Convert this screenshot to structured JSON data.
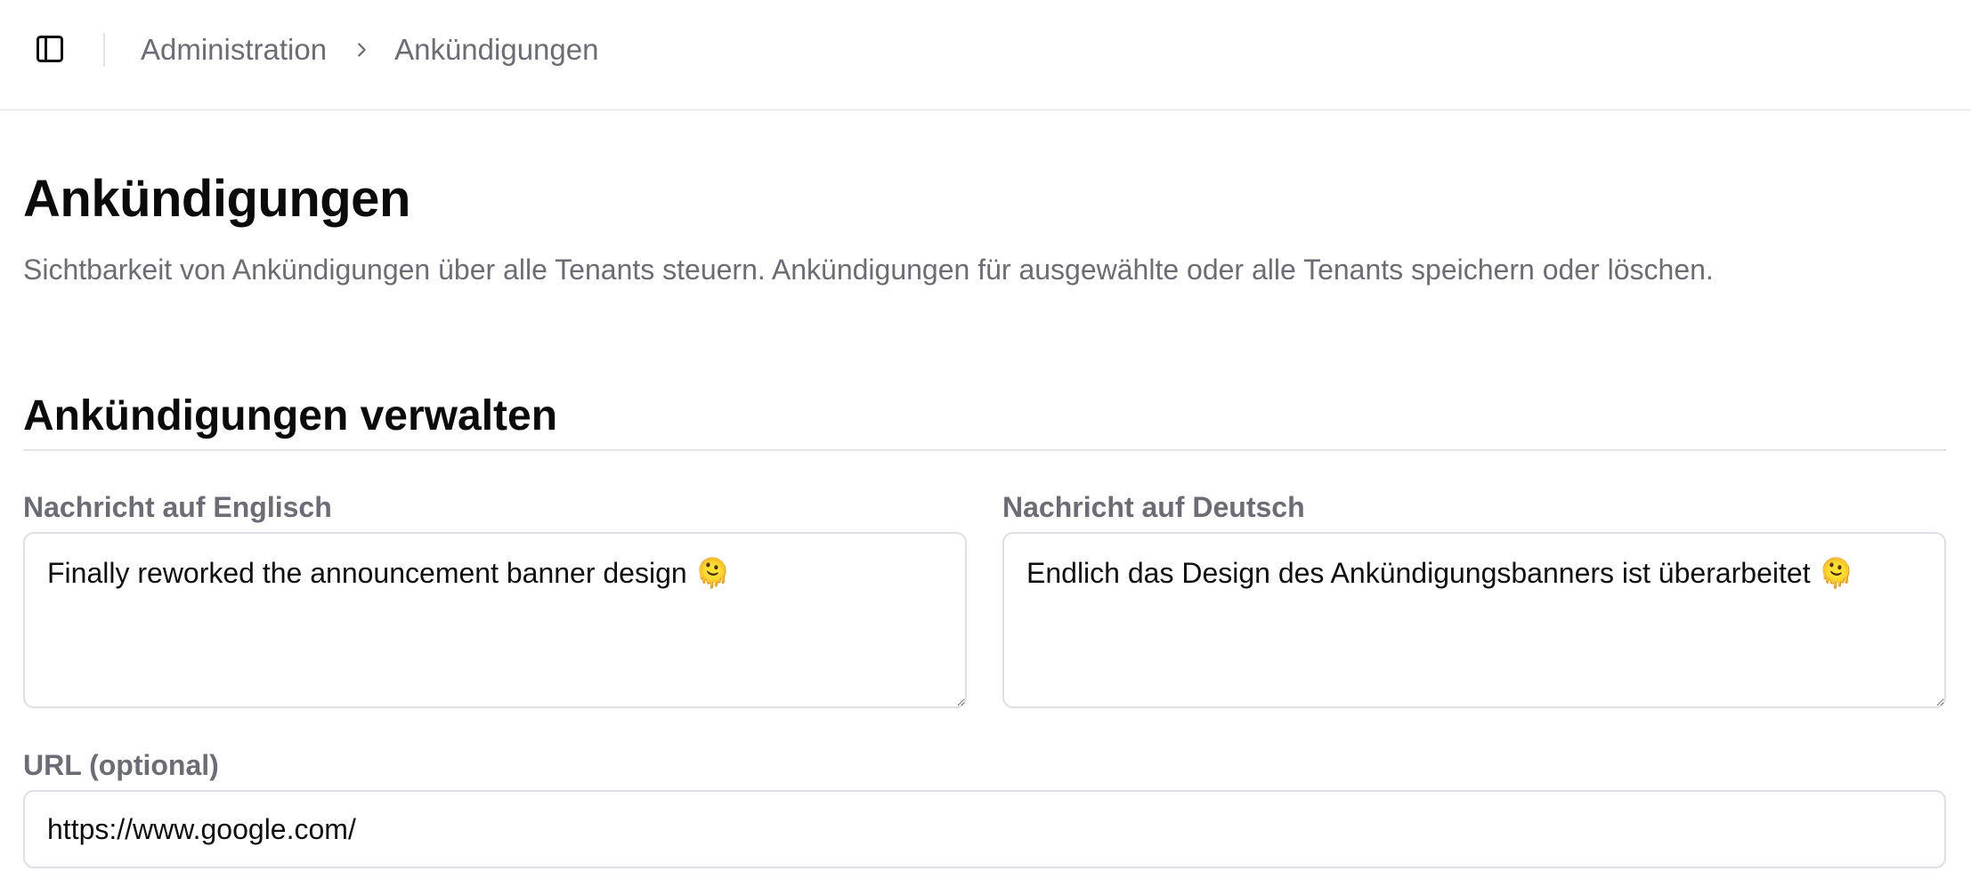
{
  "breadcrumb": {
    "items": [
      "Administration",
      "Ankündigungen"
    ]
  },
  "page": {
    "title": "Ankündigungen",
    "description": "Sichtbarkeit von Ankündigungen über alle Tenants steuern. Ankündigungen für ausgewählte oder alle Tenants speichern oder löschen."
  },
  "section": {
    "title": "Ankündigungen verwalten"
  },
  "form": {
    "message_en": {
      "label": "Nachricht auf Englisch",
      "value": "Finally reworked the announcement banner design 🫠"
    },
    "message_de": {
      "label": "Nachricht auf Deutsch",
      "value": "Endlich das Design des Ankündigungsbanners ist überarbeitet 🫠"
    },
    "url": {
      "label": "URL (optional)",
      "value": "https://www.google.com/"
    }
  },
  "colors": {
    "muted_text": "#6b6c75",
    "border": "#dfe0e4",
    "heading": "#0b0b0c"
  },
  "icons": {
    "sidebar_toggle": "sidebar-panel-icon",
    "breadcrumb_separator": "chevron-right-icon"
  }
}
